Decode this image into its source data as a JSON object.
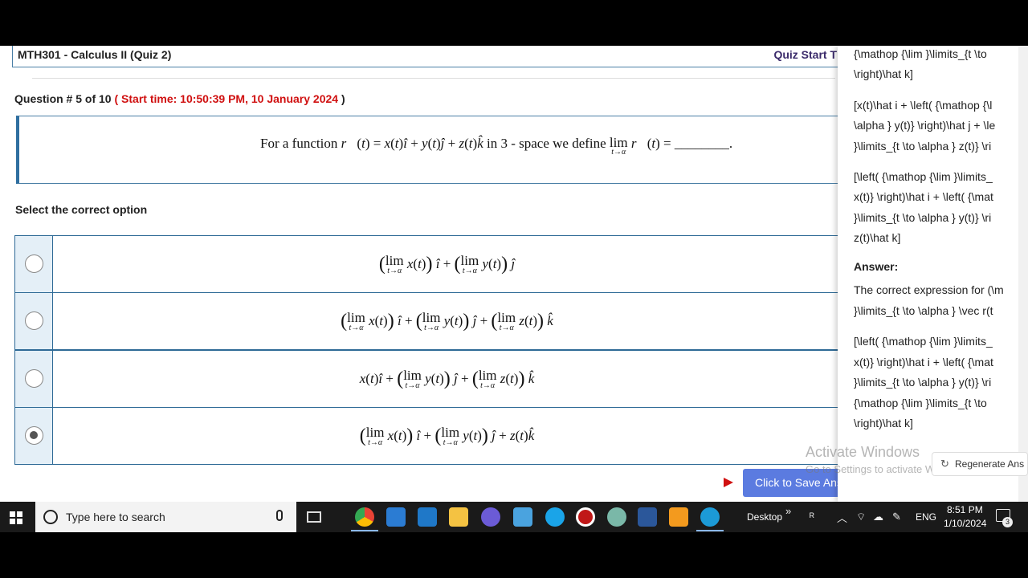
{
  "quiz": {
    "title": "MTH301 - Calculus II (Quiz 2)",
    "start_label": "Quiz Start T"
  },
  "question": {
    "number_text": "Question # 5 of 10",
    "start_time": "( Start time: 10:50:39 PM, 10 January 2024",
    "close_paren": " )",
    "text_a": "For a function",
    "text_b": "in 3 - space we define",
    "blank": "________."
  },
  "select_label": "Select the correct option",
  "options": [
    {
      "selected": false
    },
    {
      "selected": false
    },
    {
      "selected": false
    },
    {
      "selected": true
    }
  ],
  "save_button": "Click to Save Answer",
  "side_panel": {
    "lines": [
      "{\\mathop {\\lim }\\limits_{t \\to",
      "\\right)\\hat k]",
      "[x(t)\\hat i + \\left( {\\mathop {\\l",
      "\\alpha } y(t)} \\right)\\hat j + \\le",
      "}\\limits_{t \\to \\alpha } z(t)} \\ri",
      "[\\left( {\\mathop {\\lim }\\limits_",
      "x(t)} \\right)\\hat i + \\left( {\\mat",
      "}\\limits_{t \\to \\alpha } y(t)} \\ri",
      "z(t)\\hat k]",
      "Answer:",
      "The correct expression for (\\m",
      "}\\limits_{t \\to \\alpha } \\vec r(t",
      "[\\left( {\\mathop {\\lim }\\limits_",
      "x(t)} \\right)\\hat i + \\left( {\\mat",
      "}\\limits_{t \\to \\alpha } y(t)} \\ri",
      "{\\mathop {\\lim }\\limits_{t \\to",
      "\\right)\\hat k]"
    ],
    "regenerate": "Regenerate Ans"
  },
  "watermark": {
    "line1": "Activate Windows",
    "line2": "Go to Settings to activate Windows."
  },
  "taskbar": {
    "search_placeholder": "Type here to search",
    "desktop_label": "Desktop",
    "lang": "ENG",
    "time": "8:51 PM",
    "date": "1/10/2024",
    "notif_count": "3"
  },
  "colors": {
    "accent_border": "#2e6a96",
    "start_time_red": "#d01010",
    "save_button": "#5b7be0"
  }
}
